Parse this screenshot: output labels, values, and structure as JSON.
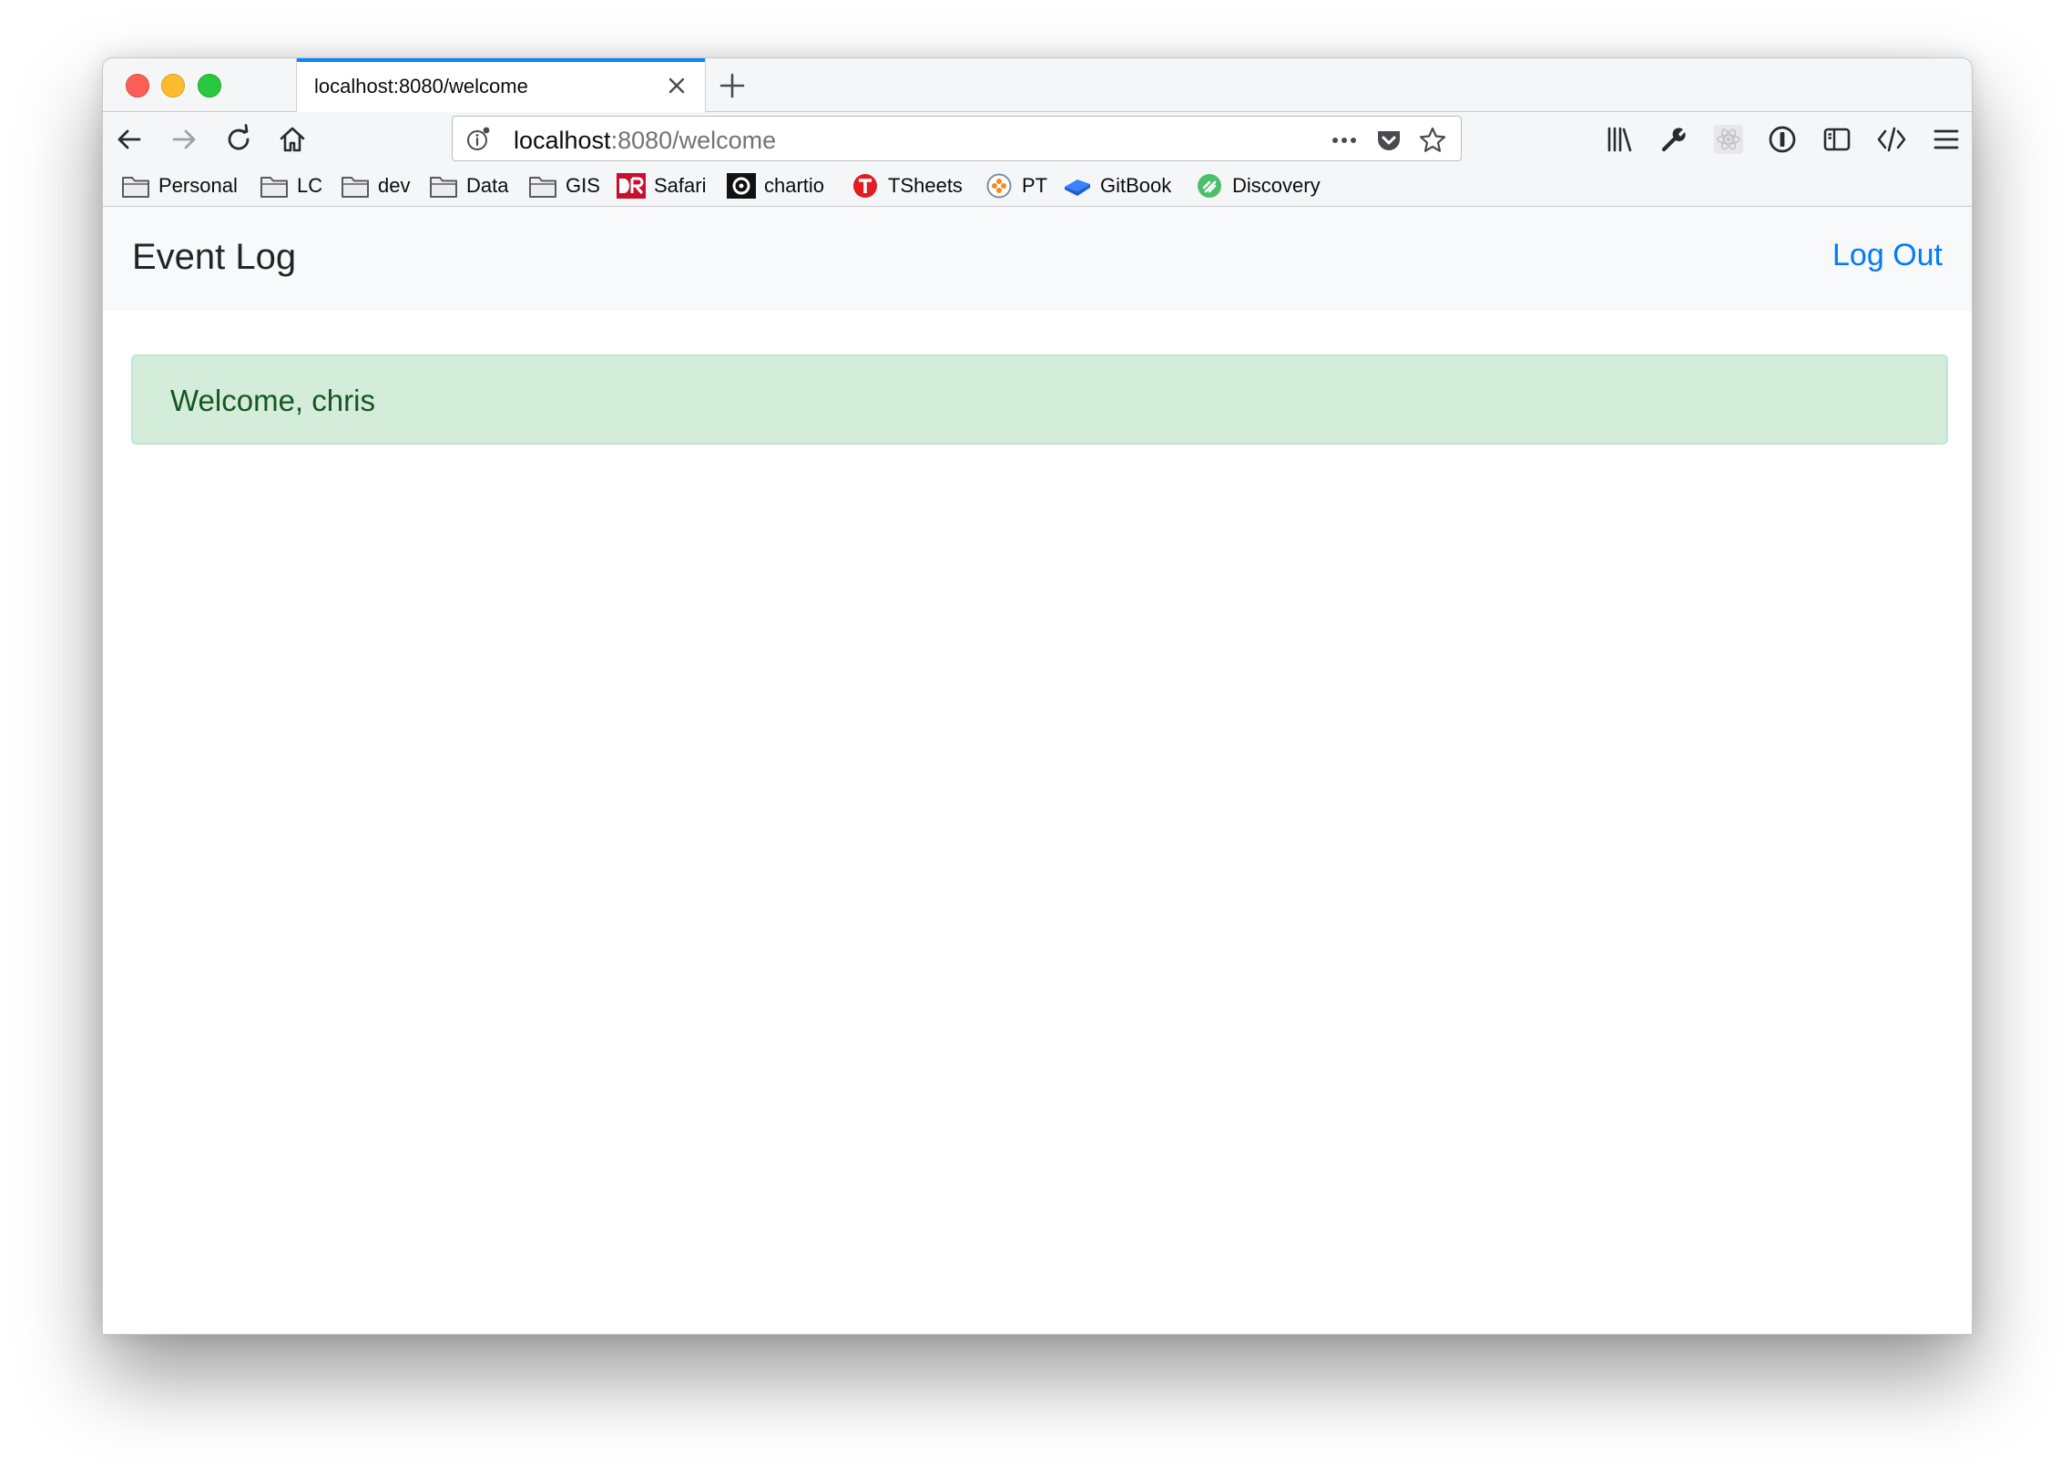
{
  "browser": {
    "tab": {
      "title": "localhost:8080/welcome"
    },
    "url": {
      "host": "localhost",
      "rest": ":8080/welcome"
    },
    "bookmarks": [
      {
        "label": "Personal",
        "icon": "folder-icon"
      },
      {
        "label": "LC",
        "icon": "folder-icon"
      },
      {
        "label": "dev",
        "icon": "folder-icon"
      },
      {
        "label": "Data",
        "icon": "folder-icon"
      },
      {
        "label": "GIS",
        "icon": "folder-icon"
      },
      {
        "label": "Safari",
        "icon": "safari-books-icon"
      },
      {
        "label": "chartio",
        "icon": "chartio-icon"
      },
      {
        "label": "TSheets",
        "icon": "tsheets-icon"
      },
      {
        "label": "PT",
        "icon": "pivotal-tracker-icon"
      },
      {
        "label": "GitBook",
        "icon": "gitbook-icon"
      },
      {
        "label": "Discovery",
        "icon": "discovery-icon"
      }
    ]
  },
  "app": {
    "brand": "Event Log",
    "logout_label": "Log Out",
    "alert": {
      "message": "Welcome, chris"
    }
  },
  "colors": {
    "accent": "#0a84ff",
    "link": "#007bff",
    "alert_bg": "#d4edda",
    "alert_text": "#155724"
  }
}
